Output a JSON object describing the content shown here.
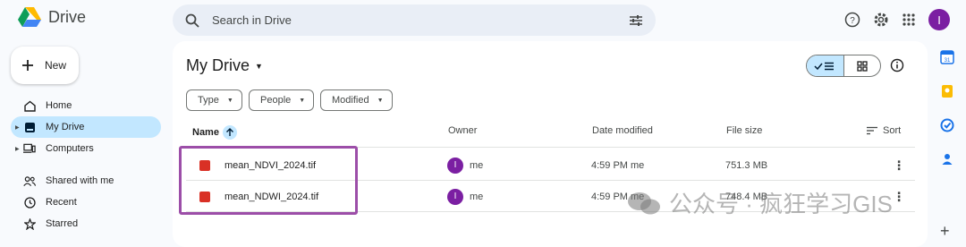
{
  "app": {
    "name": "Drive"
  },
  "search": {
    "placeholder": "Search in Drive"
  },
  "user": {
    "initial": "I",
    "color": "#7b1fa2"
  },
  "new_button": {
    "label": "New"
  },
  "sidebar": {
    "items": [
      {
        "label": "Home",
        "icon": "home-icon"
      },
      {
        "label": "My Drive",
        "icon": "my-drive-icon",
        "active": true
      },
      {
        "label": "Computers",
        "icon": "computers-icon"
      },
      {
        "label": "Shared with me",
        "icon": "shared-icon"
      },
      {
        "label": "Recent",
        "icon": "clock-icon"
      },
      {
        "label": "Starred",
        "icon": "star-icon"
      }
    ]
  },
  "main": {
    "title": "My Drive",
    "filters": [
      "Type",
      "People",
      "Modified"
    ],
    "columns": {
      "name": "Name",
      "owner": "Owner",
      "date": "Date modified",
      "size": "File size",
      "sort": "Sort"
    },
    "files": [
      {
        "name": "mean_NDVI_2024.tif",
        "owner_initial": "I",
        "owner": "me",
        "date": "4:59 PM me",
        "size": "751.3 MB"
      },
      {
        "name": "mean_NDWI_2024.tif",
        "owner_initial": "I",
        "owner": "me",
        "date": "4:59 PM me",
        "size": "748.4 MB"
      }
    ]
  },
  "watermark": {
    "text": "公众号 · 疯狂学习GIS"
  },
  "colors": {
    "accent": "#c2e7ff",
    "highlight_border": "#9c4ea8",
    "image_file": "#d93025"
  }
}
